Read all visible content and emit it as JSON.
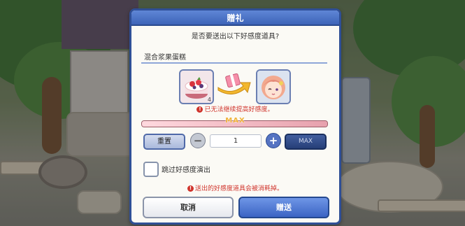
{
  "dialog": {
    "title": "贈礼",
    "question": "是否要送出以下好感度道具?",
    "item_name": "混合浆果蛋糕",
    "item_count": "4",
    "warning": "已无法继续提高好感度。",
    "affection_max_label": "MAX",
    "affection_fill_fraction": 1.0,
    "reset_label": "重置",
    "minus_symbol": "−",
    "quantity": "1",
    "plus_symbol": "+",
    "max_button_label": "MAX",
    "skip_label": "跳过好感度演出",
    "consume_note": "送出的好感度道具会被消耗掉。",
    "cancel_label": "取消",
    "gift_label": "贈送",
    "warn_icon_glyph": "!"
  },
  "icons": {
    "item": "berry-cake-icon",
    "transfer": "gift-arrow-icon",
    "character": "character-portrait-icon",
    "warning": "warning-icon"
  },
  "colors": {
    "accent": "#3d64b8",
    "warning": "#d0342c",
    "max": "#f0b33a"
  }
}
